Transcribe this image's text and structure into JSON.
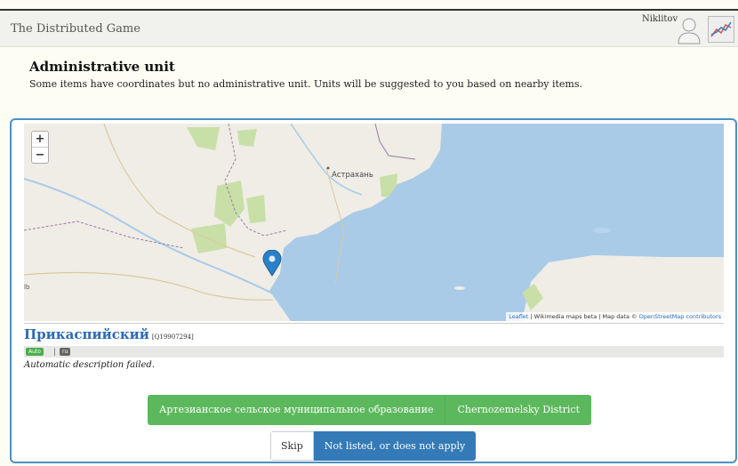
{
  "navbar": {
    "brand": "The Distributed Game",
    "username": "Niklitov",
    "avatar_icon": "user-icon",
    "stats_icon": "chart-icon"
  },
  "header": {
    "title": "Administrative unit",
    "subtitle": "Some items have coordinates but no administrative unit. Units will be suggested to you based on nearby items."
  },
  "map": {
    "zoom_in": "+",
    "zoom_out": "−",
    "city_label": "Астрахань",
    "edge_label": "lb",
    "marker_icon": "map-pin-icon",
    "attribution": {
      "leaflet": "Leaflet",
      "sep1": " | Wikimedia maps beta | Map data © ",
      "osm": "OpenStreetMap contributors"
    },
    "colors": {
      "water": "#a9cbe8",
      "land": "#efede5",
      "green": "#c9dfa8",
      "marker": "#2a81cb"
    }
  },
  "item": {
    "label": "Прикаспийский",
    "qid": "[Q19907294]",
    "badges": {
      "auto": "Auto",
      "separator": "|",
      "lang": "ru"
    },
    "description": "Automatic description failed."
  },
  "actions": {
    "options": [
      "Артезианское сельское муниципальное образование",
      "Chernozemelsky District"
    ],
    "skip": "Skip",
    "not_listed": "Not listed, or does not apply",
    "colors": {
      "success": "#5cb85c",
      "primary": "#337ab7"
    }
  }
}
